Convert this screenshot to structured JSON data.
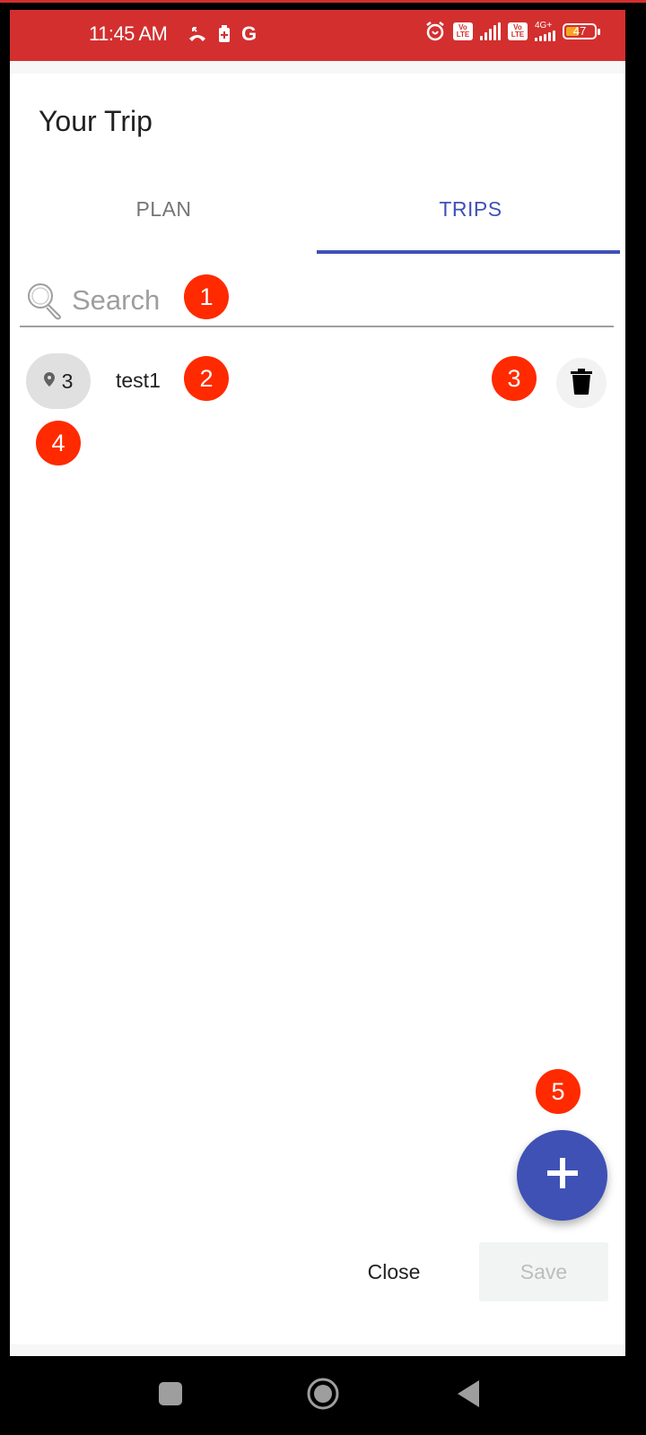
{
  "status_bar": {
    "time": "11:45 AM",
    "left_icons": [
      "missed-call-icon",
      "battery-saver-icon",
      "google-icon"
    ],
    "right_icons": [
      "alarm-icon",
      "volte-icon",
      "signal-icon",
      "volte-icon",
      "4g-plus-signal-icon",
      "battery-icon"
    ],
    "volte_label_top": "Vo",
    "volte_label_bottom": "LTE",
    "network_label": "4G+",
    "battery_level": "47",
    "battery_percent": 47,
    "color": "#d32f2f"
  },
  "header": {
    "title": "Your Trip"
  },
  "tabs": [
    {
      "label": "PLAN",
      "active": false
    },
    {
      "label": "TRIPS",
      "active": true
    }
  ],
  "accent_color": "#3f51b5",
  "search": {
    "placeholder": "Search",
    "value": ""
  },
  "trips": [
    {
      "name": "test1",
      "place_count": "3"
    }
  ],
  "annotations": [
    "1",
    "2",
    "3",
    "4",
    "5"
  ],
  "annotation_color": "#ff2a00",
  "footer": {
    "close_label": "Close",
    "save_label": "Save",
    "save_enabled": false
  },
  "fab": {
    "icon": "plus-icon"
  },
  "nav_bar": {
    "buttons": [
      "recents-icon",
      "home-icon",
      "back-icon"
    ]
  }
}
